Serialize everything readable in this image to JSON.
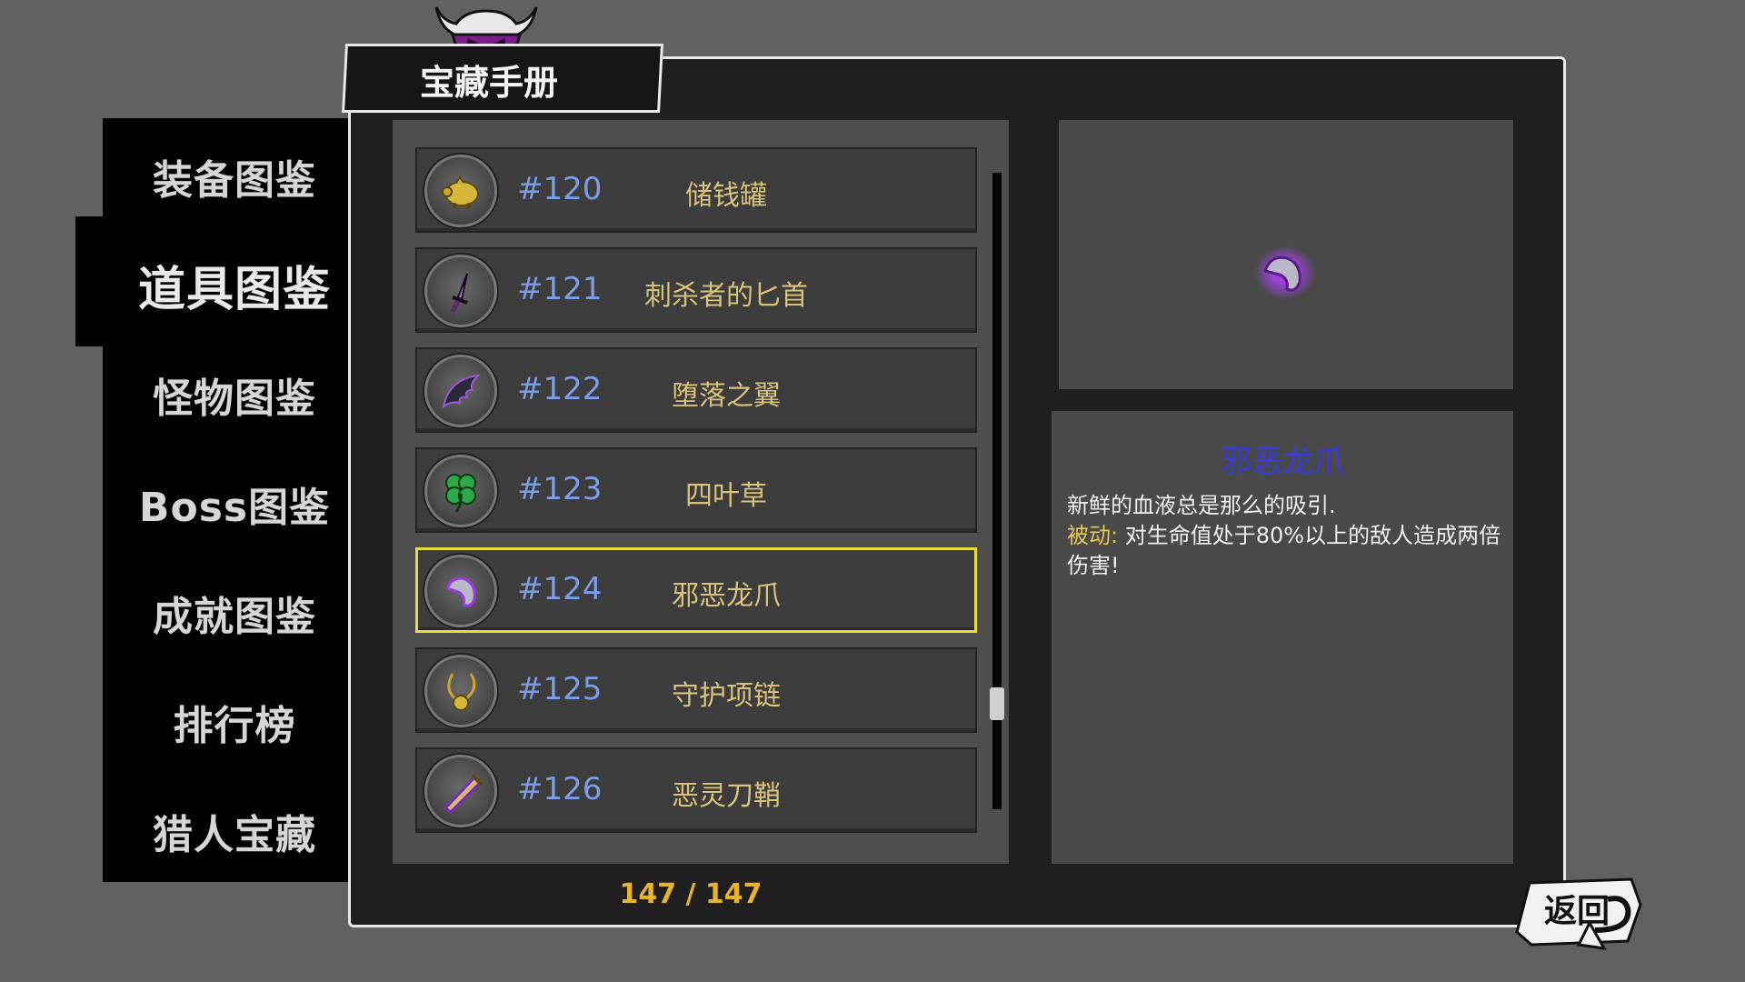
{
  "header": {
    "title": "宝藏手册",
    "emblem_icon": "horned-helmet-icon"
  },
  "sidebar": {
    "items": [
      {
        "label": "装备图鉴",
        "active": false
      },
      {
        "label": "道具图鉴",
        "active": true
      },
      {
        "label": "怪物图鉴",
        "active": false
      },
      {
        "label": "Boss图鉴",
        "active": false
      },
      {
        "label": "成就图鉴",
        "active": false
      },
      {
        "label": "排行榜",
        "active": false
      },
      {
        "label": "猎人宝藏",
        "active": false
      }
    ]
  },
  "list": {
    "items": [
      {
        "num": "#120",
        "name": "储钱罐",
        "icon": "piggy-bank-icon",
        "selected": false
      },
      {
        "num": "#121",
        "name": "刺杀者的匕首",
        "icon": "dagger-icon",
        "selected": false
      },
      {
        "num": "#122",
        "name": "堕落之翼",
        "icon": "fallen-wing-icon",
        "selected": false
      },
      {
        "num": "#123",
        "name": "四叶草",
        "icon": "four-leaf-clover-icon",
        "selected": false
      },
      {
        "num": "#124",
        "name": "邪恶龙爪",
        "icon": "dragon-claw-icon",
        "selected": true
      },
      {
        "num": "#125",
        "name": "守护项链",
        "icon": "necklace-icon",
        "selected": false
      },
      {
        "num": "#126",
        "name": "恶灵刀鞘",
        "icon": "scabbard-icon",
        "selected": false
      }
    ],
    "counter": "147 / 147",
    "scroll_position": 0.84
  },
  "detail": {
    "icon": "dragon-claw-icon",
    "name": "邪恶龙爪",
    "description": "新鲜的血液总是那么的吸引.",
    "passive_label": "被动:",
    "passive_text": " 对生命值处于80%以上的敌人造成两倍伤害!"
  },
  "back_button": {
    "label": "返回"
  },
  "colors": {
    "accent_yellow": "#e8e03a",
    "item_number_blue": "#7c9de8",
    "item_name_gold": "#d9c27a",
    "detail_name_blue": "#3a3ae0",
    "counter_orange": "#e8b52a"
  }
}
